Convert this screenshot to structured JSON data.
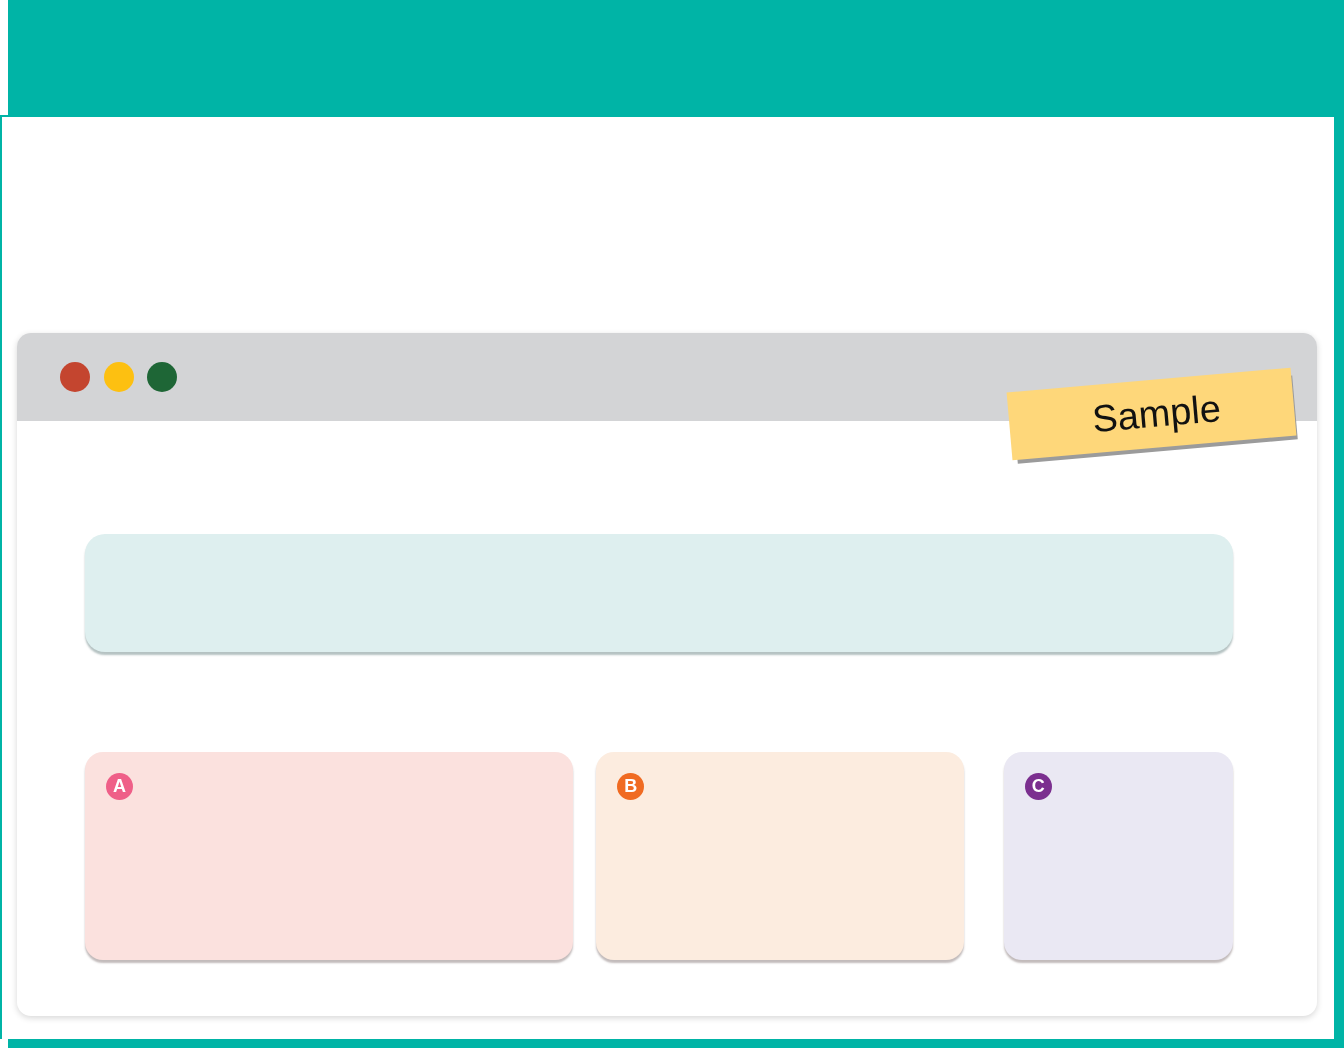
{
  "window": {
    "controls": [
      {
        "color": "#c4452f"
      },
      {
        "color": "#fdc011"
      },
      {
        "color": "#1e6636"
      }
    ],
    "sticky_note": {
      "text": "Sample"
    }
  },
  "cards": [
    {
      "color": "#fbe1de",
      "badge": {
        "label": "A",
        "color": "#ef5f88"
      }
    },
    {
      "color": "#fcecdf",
      "badge": {
        "label": "B",
        "color": "#f06b22"
      }
    },
    {
      "color": "#eae8f3",
      "badge": {
        "label": "C",
        "color": "#7b2f8f"
      }
    }
  ]
}
